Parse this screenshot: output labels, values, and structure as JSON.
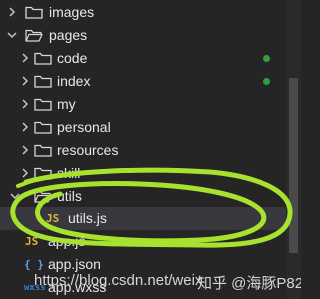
{
  "explorer": {
    "items": [
      {
        "label": "images",
        "type": "folder",
        "expanded": false,
        "level": 0
      },
      {
        "label": "pages",
        "type": "folder",
        "expanded": true,
        "level": 0
      },
      {
        "label": "code",
        "type": "folder",
        "expanded": false,
        "level": 1,
        "status_dot": true
      },
      {
        "label": "index",
        "type": "folder",
        "expanded": false,
        "level": 1,
        "status_dot": true
      },
      {
        "label": "my",
        "type": "folder",
        "expanded": false,
        "level": 1
      },
      {
        "label": "personal",
        "type": "folder",
        "expanded": false,
        "level": 1
      },
      {
        "label": "resources",
        "type": "folder",
        "expanded": false,
        "level": 1
      },
      {
        "label": "skill",
        "type": "folder",
        "expanded": false,
        "level": 1
      },
      {
        "label": "utils",
        "type": "folder",
        "expanded": true,
        "level": 0
      },
      {
        "label": "utils.js",
        "type": "file",
        "file_icon": "JS",
        "level": 1,
        "selected": true
      },
      {
        "label": "app.js",
        "type": "file",
        "file_icon": "JS",
        "level": 0
      },
      {
        "label": "app.json",
        "type": "file",
        "file_icon": "{ }",
        "level": 0
      },
      {
        "label": "app.wxss",
        "type": "file",
        "file_icon": "wxss",
        "level": 0
      }
    ]
  },
  "watermark": {
    "url_text": "https://blog.csdn.net/weix",
    "overlay_text": "知乎 @海豚P82"
  },
  "colors": {
    "background": "#252526",
    "selected_row": "#37373d",
    "js_icon": "#d7ba3a",
    "json_icon": "#5aa0e6",
    "wxss_icon": "#3a7bd5",
    "status_dot": "#2ea043",
    "annotation_stroke": "#a6e22e"
  }
}
